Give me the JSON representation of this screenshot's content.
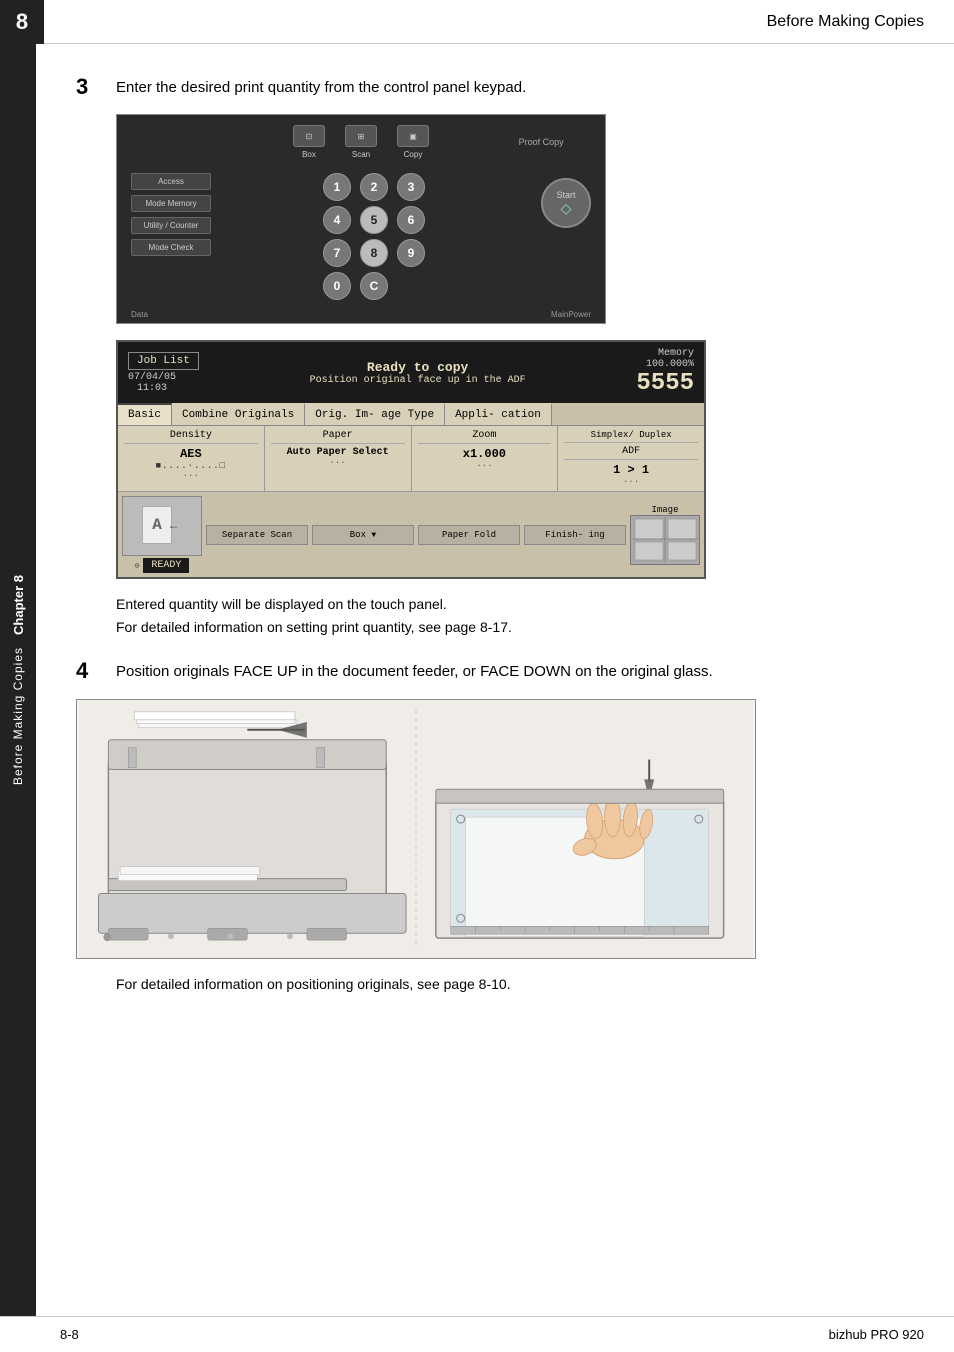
{
  "header": {
    "chapter_number": "8",
    "title": "Before Making Copies"
  },
  "sidebar": {
    "chapter_label": "Chapter 8",
    "section_label": "Before Making Copies"
  },
  "step3": {
    "number": "3",
    "text": "Enter the desired print quantity from the control panel keypad."
  },
  "lcd_panel": {
    "job_list": "Job List",
    "date": "07/04/05",
    "time": "11:03",
    "status_line1": "Ready to copy",
    "status_line2": "Position original face up in the ADF",
    "memory_label": "Memory",
    "memory_value": "100.000%",
    "count": "5555",
    "tabs": [
      "Basic",
      "Combine Originals",
      "Orig. Im- age Type",
      "Appli- cation"
    ],
    "density_label": "Density",
    "density_value": "AES",
    "density_dots": "■....·....□",
    "paper_label": "Paper",
    "paper_value": "Auto Paper Select",
    "paper_dots": "···",
    "zoom_label": "Zoom",
    "zoom_value": "x1.000",
    "zoom_dots": "···",
    "simplex_label": "Simplex/ Duplex",
    "adf_label": "ADF",
    "adf_value": "1 > 1",
    "adf_dots": "···",
    "separate_scan_label": "Separate Scan",
    "box_label": "Box",
    "paper_fold_label": "Paper Fold",
    "finishing_label": "Finish- ing",
    "image_label": "Image",
    "ready_text": "READY"
  },
  "caption3": {
    "line1": "Entered quantity will be displayed on the touch panel.",
    "line2": "For detailed information on setting print quantity, see page 8-17."
  },
  "step4": {
    "number": "4",
    "text": "Position originals FACE UP in the document feeder, or FACE DOWN on the original glass."
  },
  "caption4": {
    "text": "For detailed information on positioning originals, see page 8-10."
  },
  "footer": {
    "page": "8-8",
    "brand": "bizhub PRO 920"
  },
  "control_panel": {
    "box_label": "Box",
    "scan_label": "Scan",
    "copy_label": "Copy",
    "access_label": "Access",
    "mode_memory_label": "Mode Memory",
    "utility_counter_label": "Utility / Counter",
    "mode_check_label": "Mode Check",
    "proof_copy_label": "Proof Copy",
    "start_label": "Start",
    "data_label": "Data",
    "main_power_label": "MainPower",
    "numpad": [
      "1",
      "2",
      "3",
      "4",
      "5",
      "6",
      "7",
      "8",
      "9",
      "0",
      "C"
    ],
    "highlighted_keys": [
      "5",
      "8"
    ]
  }
}
